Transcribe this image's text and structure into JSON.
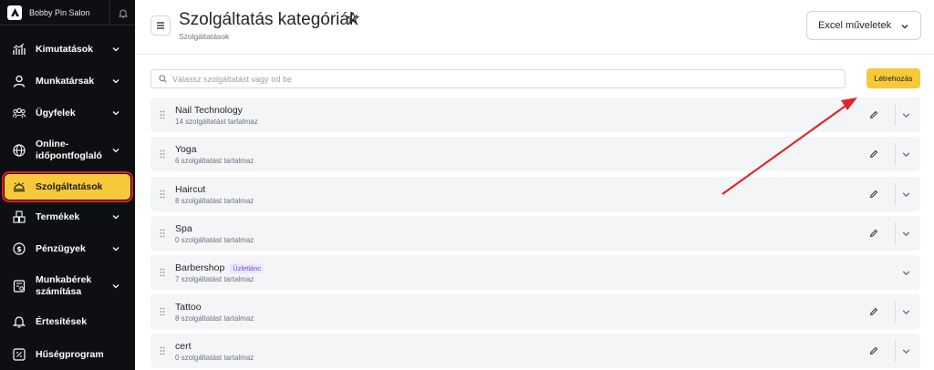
{
  "brand": {
    "name": "Bobby Pin Salon"
  },
  "sidebar": {
    "items": [
      {
        "label": "Kimutatások",
        "icon": "chart-icon",
        "has_chevron": true
      },
      {
        "label": "Munkatársak",
        "icon": "user-icon",
        "has_chevron": true
      },
      {
        "label": "Ügyfelek",
        "icon": "users-icon",
        "has_chevron": true
      },
      {
        "label": "Online-időpontfoglaló",
        "icon": "globe-icon",
        "has_chevron": true
      },
      {
        "label": "Szolgáltatások",
        "icon": "service-bell-icon",
        "has_chevron": false,
        "active": true
      },
      {
        "label": "Termékek",
        "icon": "products-icon",
        "has_chevron": true
      },
      {
        "label": "Pénzügyek",
        "icon": "dollar-icon",
        "has_chevron": true
      },
      {
        "label": "Munkabérek számítása",
        "icon": "payroll-icon",
        "has_chevron": true
      },
      {
        "label": "Értesítések",
        "icon": "bell-icon",
        "has_chevron": false
      },
      {
        "label": "Hűségprogram",
        "icon": "percent-icon",
        "has_chevron": false
      }
    ]
  },
  "header": {
    "title": "Szolgáltatás kategóriák",
    "subtitle": "Szolgáltatások",
    "excel_label": "Excel műveletek"
  },
  "search": {
    "placeholder": "Válassz szolgáltatást vagy írd be",
    "value": ""
  },
  "create_label": "Létrehozás",
  "categories": [
    {
      "name": "Nail Technology",
      "count_text": "14 szolgáltatást tartalmaz",
      "editable": true
    },
    {
      "name": "Yoga",
      "count_text": "6 szolgáltatást tartalmaz",
      "editable": true
    },
    {
      "name": "Haircut",
      "count_text": "8 szolgáltatást tartalmaz",
      "editable": true
    },
    {
      "name": "Spa",
      "count_text": "0 szolgáltatást tartalmaz",
      "editable": true
    },
    {
      "name": "Barbershop",
      "badge": "Üzletlánc",
      "count_text": "7 szolgáltatást tartalmaz",
      "editable": false
    },
    {
      "name": "Tattoo",
      "count_text": "8 szolgáltatást tartalmaz",
      "editable": true
    },
    {
      "name": "cert",
      "count_text": "0 szolgáltatást tartalmaz",
      "editable": true
    }
  ],
  "colors": {
    "accent": "#f7c93a",
    "sidebar_bg": "#0e0f12",
    "highlight": "#e01e2b",
    "badge": "#6d4dd6"
  }
}
